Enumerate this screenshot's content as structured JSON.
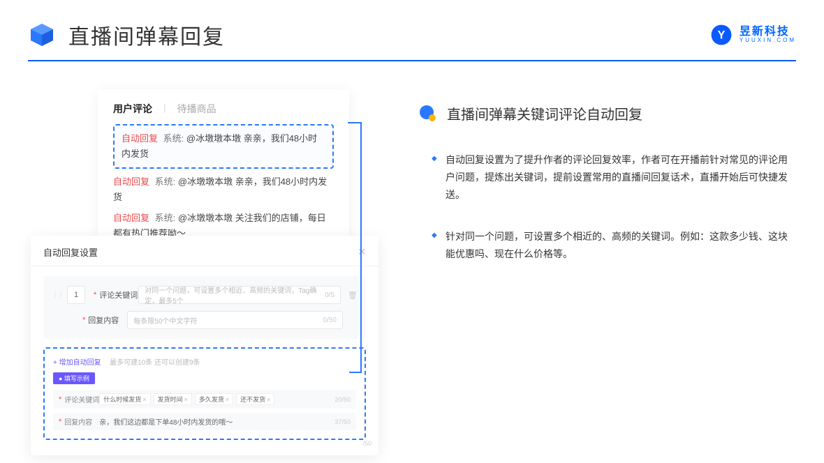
{
  "header": {
    "page_title": "直播间弹幕回复",
    "brand_top": "昱新科技",
    "brand_bot": "YUUXIN.COM"
  },
  "card1": {
    "tabs": {
      "active": "用户评论",
      "sep": "|",
      "inactive": "待播商品"
    },
    "comments": [
      {
        "tag": "自动回复",
        "sys": "系统:",
        "text": "@冰墩墩本墩 亲亲，我们48小时内发货"
      },
      {
        "tag": "自动回复",
        "sys": "系统:",
        "text": "@冰墩墩本墩 亲亲，我们48小时内发货"
      },
      {
        "tag": "自动回复",
        "sys": "系统:",
        "text": "@冰墩墩本墩 关注我们的店铺，每日都有热门推荐呦～"
      }
    ]
  },
  "card2": {
    "title": "自动回复设置",
    "idx": "1",
    "row1": {
      "label": "评论关键词",
      "placeholder": "对同一个问题，可设置多个相近、高频的关键词，Tag确定，最多5个",
      "cnt": "0/5"
    },
    "row2": {
      "label": "回复内容",
      "placeholder": "每条限50个中文字符",
      "cnt": "0/50"
    },
    "add_link": "+ 增加自动回复",
    "add_hint": "最多可建10条 还可以创建9条",
    "ex_badge": "● 填写示例",
    "ex_row1": {
      "label": "评论关键词",
      "tags": [
        "什么时候发货",
        "发货时间",
        "多久发货",
        "还不发货"
      ],
      "cnt": "20/50"
    },
    "ex_row2": {
      "label": "回复内容",
      "text": "亲，我们这边都是下单48小时内发货的哦～",
      "cnt": "37/50"
    },
    "float_cnt": "/50"
  },
  "right": {
    "section_title": "直播间弹幕关键词评论自动回复",
    "bullets": [
      "自动回复设置为了提升作者的评论回复效率，作者可在开播前针对常见的评论用户问题，提炼出关键词，提前设置常用的直播间回复话术，直播开始后可快捷发送。",
      "针对同一个问题，可设置多个相近的、高频的关键词。例如：这款多少钱、这块能优惠吗、现在什么价格等。"
    ]
  }
}
